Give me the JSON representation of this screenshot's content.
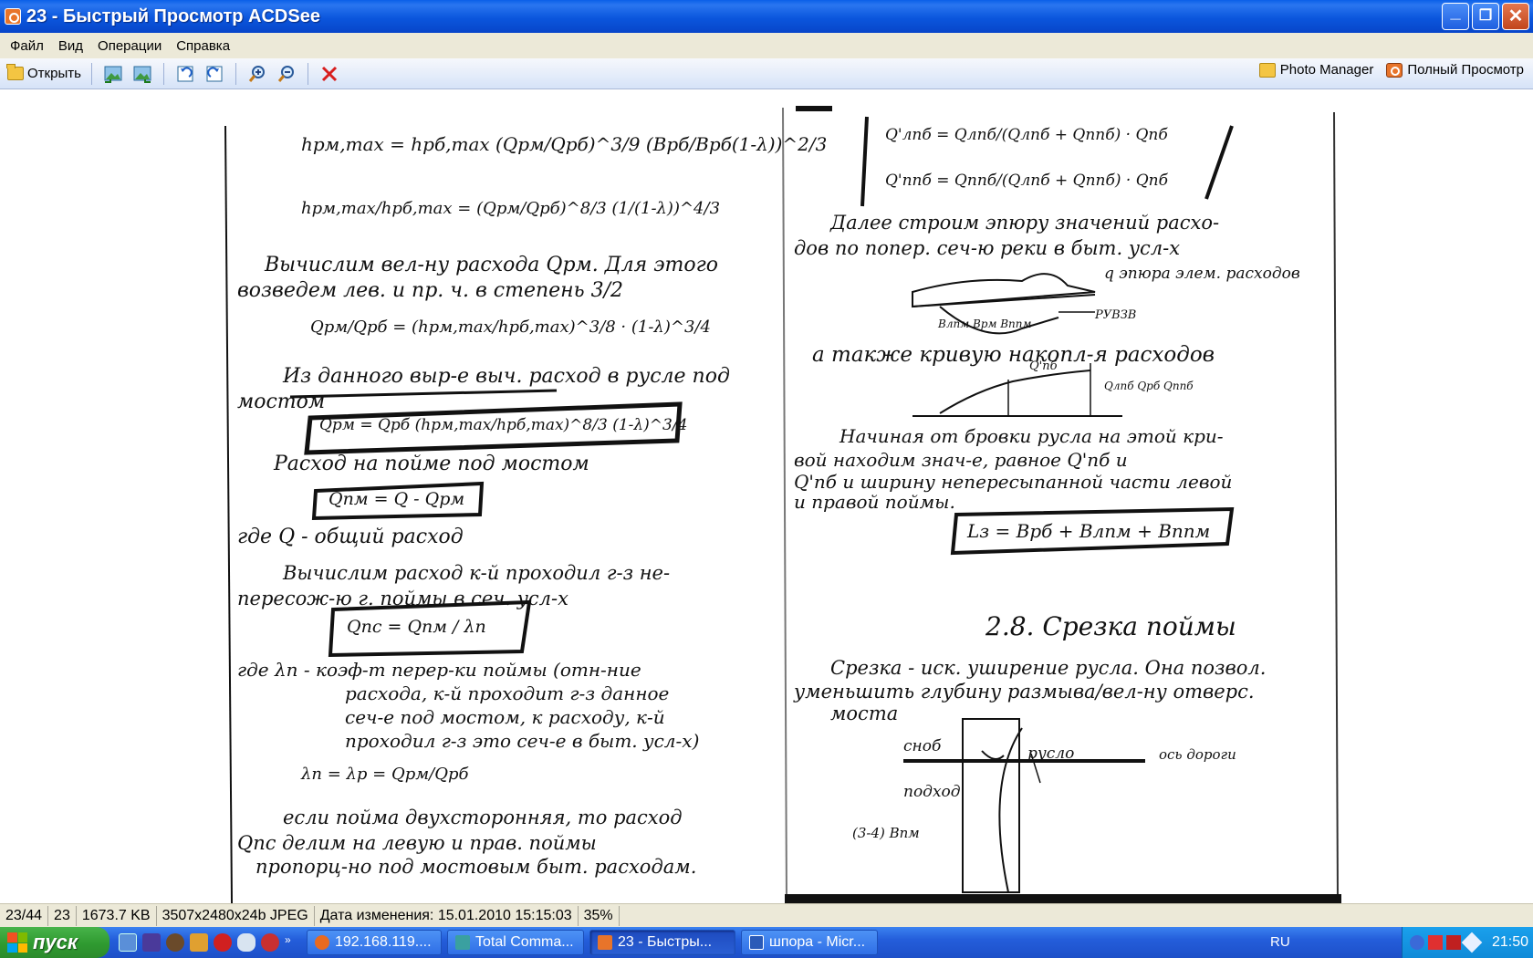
{
  "window": {
    "title": "23 - Быстрый Просмотр ACDSee"
  },
  "menu": {
    "items": [
      "Файл",
      "Вид",
      "Операции",
      "Справка"
    ]
  },
  "toolbar": {
    "open_label": "Открыть",
    "photo_manager_label": "Photo Manager",
    "full_view_label": "Полный Просмотр"
  },
  "document": {
    "left_page": {
      "lines": [
        "hрм,max = hрб,max (Qрм/Qрб)^3/9 (Bрб/Bрб(1-λ))^2/3",
        "hрм,max/hрб,max = (Qрм/Qрб)^8/3 (1/(1-λ))^4/3",
        "Вычислим вел-ну расхода Qрм. Для этого",
        "возведем лев. и пр. ч. в степень 3/2",
        "Qрм/Qрб = (hрм,max/hрб,max)^3/8 · (1-λ)^3/4",
        "Из данного выр-е выч. расход в русле под",
        "мостом",
        "Qрм = Qрб (hрм,max/hрб,max)^8/3 (1-λ)^3/4",
        "Расход на пойме под мостом",
        "Qпм = Q - Qрм",
        "где Q - общий расход",
        "Вычислим расход к-й проходил г-з не-",
        "пересож-ю г. поймы в сеч. усл-х",
        "Qпс = Qпм / λn",
        "где λn - коэф-т перер-ки поймы (отн-ние",
        "расхода, к-й проходит г-з данное",
        "сеч-е под мостом, к расходу, к-й",
        "проходил г-з это сеч-е в быт. усл-х)",
        "λn = λр = Qрм/Qрб",
        "если пойма двухсторонняя, то расход",
        "Qпс делим на левую и прав. поймы",
        "пропорц-но под мостовым быт. расходам."
      ]
    },
    "right_page": {
      "lines": [
        "Q'лпб = Qлпб/(Qлпб + Qппб) · Qпб",
        "Q'ппб = Qппб/(Qлпб + Qппб) · Qпб",
        "Далее строим эпюру значений расхо-",
        "дов по попер. сеч-ю реки в быт. усл-х",
        "q  эпюра элем. расходов",
        "Bлпм  Bрм  Bппм",
        "РУВЗВ",
        "а также кривую накопл-я расходов",
        "Q'пб",
        "Qлпб  Qрб  Qппб",
        "Начиная от бровки русла на этой кри-",
        "вой находим знач-е, равное Q'пб и",
        "Q'пб и ширину непересыпанной части левой",
        "и правой поймы.",
        "Lз = Bрб + Bлпм + Bппм",
        "2.8. Срезка поймы",
        "Срезка - иск. уширение русла. Она позвол.",
        "уменьшить глубину размыва/вел-ну отверс.",
        "моста",
        "сноб",
        "русло",
        "подход",
        "ось дороги",
        "(3-4) Bпм"
      ]
    }
  },
  "statusbar": {
    "position": "23/44",
    "file": "23",
    "size": "1673.7 KB",
    "format": "3507x2480x24b JPEG",
    "modified": "Дата изменения: 15.01.2010 15:15:03",
    "zoom": "35%"
  },
  "taskbar": {
    "start_label": "пуск",
    "tasks": [
      "192.168.119....",
      "Total Comma...",
      "23 - Быстры...",
      "шпора - Micr..."
    ],
    "language": "RU",
    "clock": "21:50"
  },
  "colors": {
    "titlebar": "#0b56dd",
    "menubar": "#ece9d8",
    "taskbar": "#245edb",
    "start": "#2f9a30",
    "tray": "#0f8ad8"
  }
}
